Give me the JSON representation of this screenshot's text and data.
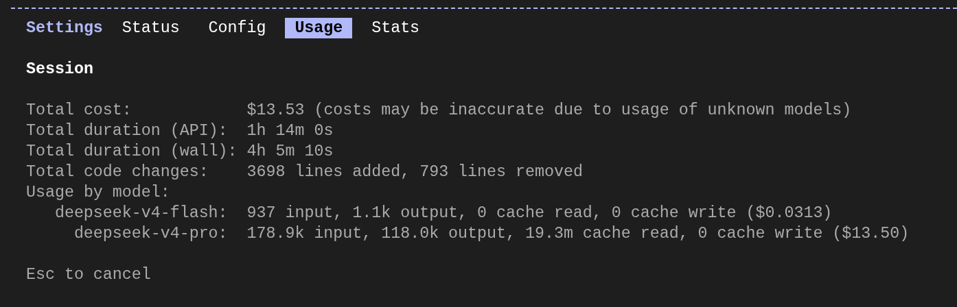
{
  "header": {
    "title": "Settings"
  },
  "tabs": [
    {
      "label": "Status",
      "selected": false
    },
    {
      "label": "Config",
      "selected": false
    },
    {
      "label": "Usage",
      "selected": true
    },
    {
      "label": "Stats",
      "selected": false
    }
  ],
  "section": {
    "title": "Session"
  },
  "rows": [
    {
      "label": "Total cost:",
      "value": "$13.53 (costs may be inaccurate due to usage of unknown models)"
    },
    {
      "label": "Total duration (API):",
      "value": "1h 14m 0s"
    },
    {
      "label": "Total duration (wall):",
      "value": "4h 5m 10s"
    },
    {
      "label": "Total code changes:",
      "value": "3698 lines added, 793 lines removed"
    },
    {
      "label": "Usage by model:"
    }
  ],
  "models": [
    {
      "name": "deepseek-v4-flash:",
      "usage": "937 input, 1.1k output, 0 cache read, 0 cache write ($0.0313)"
    },
    {
      "name": "deepseek-v4-pro:",
      "usage": "178.9k input, 118.0k output, 19.3m cache read, 0 cache write ($13.50)"
    }
  ],
  "footer": {
    "hint": "Esc to cancel"
  }
}
